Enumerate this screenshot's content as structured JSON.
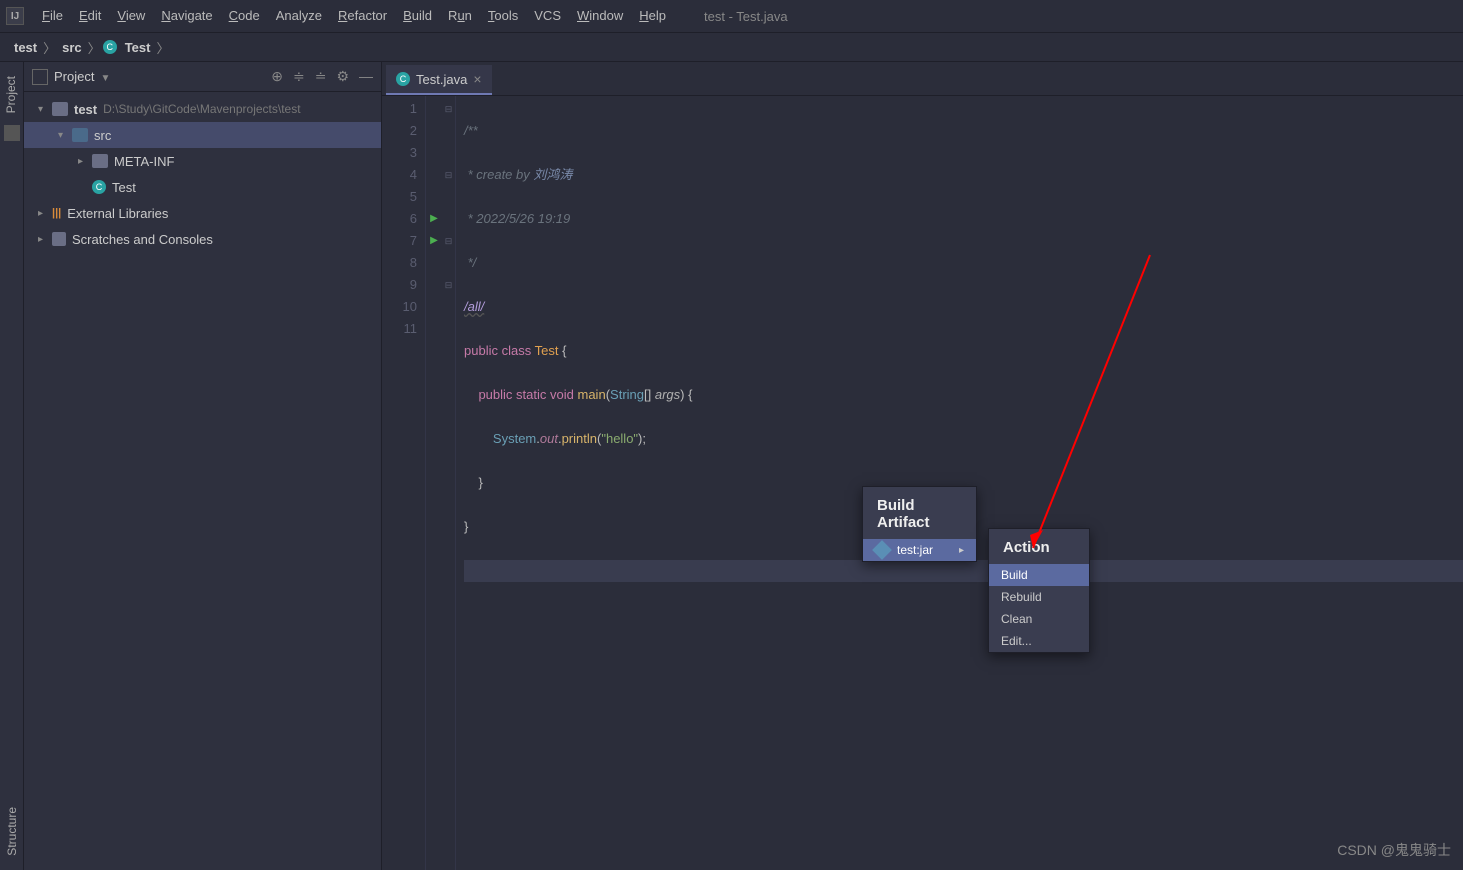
{
  "window": {
    "title": "test - Test.java"
  },
  "menu": {
    "file": "File",
    "edit": "Edit",
    "view": "View",
    "navigate": "Navigate",
    "code": "Code",
    "analyze": "Analyze",
    "refactor": "Refactor",
    "build": "Build",
    "run": "Run",
    "tools": "Tools",
    "vcs": "VCS",
    "window": "Window",
    "help": "Help"
  },
  "breadcrumb": {
    "root": "test",
    "src": "src",
    "class": "Test"
  },
  "project_panel": {
    "title": "Project",
    "root": {
      "name": "test",
      "path": "D:\\Study\\GitCode\\Mavenprojects\\test"
    },
    "src": "src",
    "meta": "META-INF",
    "test_class": "Test",
    "external": "External Libraries",
    "scratches": "Scratches and Consoles"
  },
  "sidebar": {
    "project": "Project",
    "structure": "Structure"
  },
  "tab": {
    "name": "Test.java"
  },
  "code": {
    "lines": [
      "1",
      "2",
      "3",
      "4",
      "5",
      "6",
      "7",
      "8",
      "9",
      "10",
      "11"
    ],
    "comment_open": "/**",
    "comment_author_prefix": " * create by ",
    "comment_author": "刘鸿涛",
    "comment_date": " * 2022/5/26 19:19",
    "comment_close": " */",
    "anno": "/all/",
    "kw_public": "public",
    "kw_class": "class",
    "cls_name": "Test",
    "kw_static": "static",
    "kw_void": "void",
    "m_main": "main",
    "t_string": "String",
    "p_args": "args",
    "sys": "System",
    "out": "out",
    "println": "println",
    "hello": "\"hello\""
  },
  "popup_artifact": {
    "title": "Build Artifact",
    "item": "test:jar"
  },
  "popup_action": {
    "title": "Action",
    "build": "Build",
    "rebuild": "Rebuild",
    "clean": "Clean",
    "edit": "Edit..."
  },
  "watermark": "CSDN @鬼鬼骑士"
}
